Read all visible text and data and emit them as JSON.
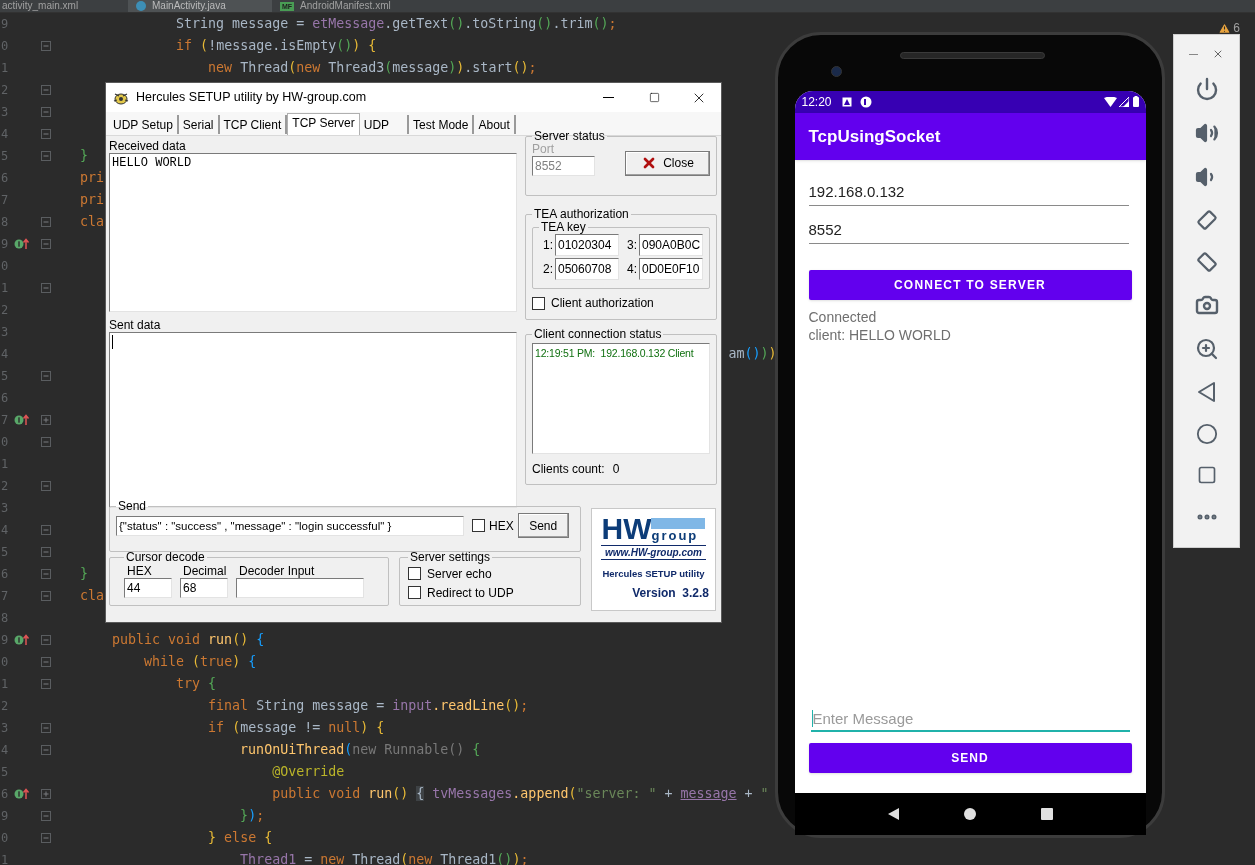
{
  "ide": {
    "tabs": [
      {
        "label": "activity_main.xml",
        "selected": false,
        "kind": "xml"
      },
      {
        "label": "MainActivity.java",
        "selected": true,
        "kind": "java"
      },
      {
        "label": "AndroidManifest.xml",
        "selected": false,
        "kind": "manifest",
        "badge": "MF"
      }
    ],
    "warnings": "6",
    "lines": [
      {
        "number": "9",
        "tokens": [
          {
            "text": "            String message = ",
            "kind": "plain"
          },
          {
            "text": "etMessage",
            "kind": "field"
          },
          {
            "text": ".getText",
            "kind": "plain"
          },
          {
            "text": "()",
            "kind": "b2"
          },
          {
            "text": ".toString",
            "kind": "plain"
          },
          {
            "text": "()",
            "kind": "b2"
          },
          {
            "text": ".trim",
            "kind": "plain"
          },
          {
            "text": "()",
            "kind": "b2"
          },
          {
            "text": ";",
            "kind": "kw"
          }
        ]
      },
      {
        "number": "0",
        "expanded": true,
        "tokens": [
          {
            "text": "            if ",
            "kind": "kw"
          },
          {
            "text": "(",
            "kind": "b1"
          },
          {
            "text": "!message.isEmpty",
            "kind": "plain"
          },
          {
            "text": "()",
            "kind": "b2"
          },
          {
            "text": ")",
            "kind": "b1"
          },
          {
            "text": " {",
            "kind": "b1"
          }
        ]
      },
      {
        "number": "1",
        "tokens": [
          {
            "text": "                new ",
            "kind": "kw"
          },
          {
            "text": "Thread",
            "kind": "plain"
          },
          {
            "text": "(",
            "kind": "b1"
          },
          {
            "text": "new ",
            "kind": "kw"
          },
          {
            "text": "Thread3",
            "kind": "plain"
          },
          {
            "text": "(",
            "kind": "b2"
          },
          {
            "text": "message",
            "kind": "plain"
          },
          {
            "text": ")",
            "kind": "b2"
          },
          {
            "text": ")",
            "kind": "b1"
          },
          {
            "text": ".start",
            "kind": "plain"
          },
          {
            "text": "()",
            "kind": "b1"
          },
          {
            "text": ";",
            "kind": "kw"
          }
        ]
      },
      {
        "number": "2",
        "expanded": true
      },
      {
        "number": "3",
        "expanded": true
      },
      {
        "number": "4",
        "expanded": true
      },
      {
        "number": "5",
        "expanded": true,
        "tokens": [
          {
            "text": "}",
            "kind": "b2"
          }
        ]
      },
      {
        "number": "6",
        "tokens": [
          {
            "text": "pri",
            "kind": "kw"
          }
        ]
      },
      {
        "number": "7",
        "tokens": [
          {
            "text": "pri",
            "kind": "kw"
          }
        ]
      },
      {
        "number": "8",
        "expanded": true,
        "tokens": [
          {
            "text": "cla",
            "kind": "kw"
          }
        ]
      },
      {
        "number": "9",
        "overridden": true,
        "expanded": true
      },
      {
        "number": "0"
      },
      {
        "number": "1",
        "expanded": true
      },
      {
        "number": "2"
      },
      {
        "number": "3"
      },
      {
        "number": "4",
        "tokens": [
          {
            "text": "                                                                                 am",
            "kind": "plain"
          },
          {
            "text": "()",
            "kind": "b3"
          },
          {
            "text": ")",
            "kind": "b2"
          },
          {
            "text": ")",
            "kind": "b1"
          }
        ]
      },
      {
        "number": "5",
        "expanded": true
      },
      {
        "number": "6"
      },
      {
        "number": "7",
        "overridden": true,
        "expanded": false
      },
      {
        "number": "0",
        "expanded": true
      },
      {
        "number": "1"
      },
      {
        "number": "2",
        "expanded": true
      },
      {
        "number": "3"
      },
      {
        "number": "4",
        "expanded": true
      },
      {
        "number": "5",
        "expanded": true
      },
      {
        "number": "6",
        "expanded": true,
        "tokens": [
          {
            "text": "}",
            "kind": "b2"
          }
        ]
      },
      {
        "number": "7",
        "expanded": true,
        "tokens": [
          {
            "text": "cla",
            "kind": "kw"
          }
        ]
      },
      {
        "number": "8"
      },
      {
        "number": "9",
        "overridden": true,
        "expanded": true,
        "tokens": [
          {
            "text": "    public void ",
            "kind": "kw"
          },
          {
            "text": "run",
            "kind": "method"
          },
          {
            "text": "()",
            "kind": "b1"
          },
          {
            "text": " {",
            "kind": "b3"
          }
        ]
      },
      {
        "number": "0",
        "expanded": true,
        "tokens": [
          {
            "text": "        while ",
            "kind": "kw"
          },
          {
            "text": "(",
            "kind": "b1"
          },
          {
            "text": "true",
            "kind": "kw"
          },
          {
            "text": ")",
            "kind": "b1"
          },
          {
            "text": " {",
            "kind": "b3"
          }
        ]
      },
      {
        "number": "1",
        "expanded": true,
        "tokens": [
          {
            "text": "            try ",
            "kind": "kw"
          },
          {
            "text": "{",
            "kind": "b2"
          }
        ]
      },
      {
        "number": "2",
        "tokens": [
          {
            "text": "                final ",
            "kind": "kw"
          },
          {
            "text": "String message = ",
            "kind": "plain"
          },
          {
            "text": "input",
            "kind": "field"
          },
          {
            "text": ".readLine",
            "kind": "method"
          },
          {
            "text": "()",
            "kind": "b1"
          },
          {
            "text": ";",
            "kind": "kw"
          }
        ]
      },
      {
        "number": "3",
        "expanded": true,
        "tokens": [
          {
            "text": "                if ",
            "kind": "kw"
          },
          {
            "text": "(",
            "kind": "b1"
          },
          {
            "text": "message != ",
            "kind": "plain"
          },
          {
            "text": "null",
            "kind": "kw"
          },
          {
            "text": ")",
            "kind": "b1"
          },
          {
            "text": " {",
            "kind": "b1"
          }
        ]
      },
      {
        "number": "4",
        "expanded": true,
        "tokens": [
          {
            "text": "                    runOnUiThread",
            "kind": "method"
          },
          {
            "text": "(",
            "kind": "b3"
          },
          {
            "text": "new Runnable",
            "kind": "dim"
          },
          {
            "text": "()",
            "kind": "dim"
          },
          {
            "text": " {",
            "kind": "b2"
          }
        ]
      },
      {
        "number": "5",
        "tokens": [
          {
            "text": "                        @Override",
            "kind": "ann"
          }
        ]
      },
      {
        "number": "6",
        "overridden": true,
        "expanded": false,
        "tokens": [
          {
            "text": "                        public void ",
            "kind": "kw"
          },
          {
            "text": "run",
            "kind": "method"
          },
          {
            "text": "() ",
            "kind": "b1"
          },
          {
            "text": "{",
            "kind": "hl"
          },
          {
            "text": " tvMessages",
            "kind": "field"
          },
          {
            "text": ".append",
            "kind": "method"
          },
          {
            "text": "(",
            "kind": "b1"
          },
          {
            "text": "\"server: \"",
            "kind": "string"
          },
          {
            "text": " + ",
            "kind": "plain"
          },
          {
            "text": "message",
            "kind": "fieldu"
          },
          {
            "text": " + ",
            "kind": "plain"
          },
          {
            "text": "\"",
            "kind": "string"
          }
        ]
      },
      {
        "number": "9",
        "expanded": true,
        "tokens": [
          {
            "text": "                    }",
            "kind": "b2"
          },
          {
            "text": ")",
            "kind": "b3"
          },
          {
            "text": ";",
            "kind": "kw"
          }
        ]
      },
      {
        "number": "0",
        "expanded": true,
        "tokens": [
          {
            "text": "                }",
            "kind": "b1"
          },
          {
            "text": " else ",
            "kind": "kw"
          },
          {
            "text": "{",
            "kind": "b1"
          }
        ]
      },
      {
        "number": "1",
        "tokens": [
          {
            "text": "                    Thread1",
            "kind": "field"
          },
          {
            "text": " = ",
            "kind": "plain"
          },
          {
            "text": "new ",
            "kind": "kw"
          },
          {
            "text": "Thread",
            "kind": "plain"
          },
          {
            "text": "(",
            "kind": "b1"
          },
          {
            "text": "new ",
            "kind": "kw"
          },
          {
            "text": "Thread1",
            "kind": "plain"
          },
          {
            "text": "()",
            "kind": "b2"
          },
          {
            "text": ")",
            "kind": "b1"
          },
          {
            "text": ";",
            "kind": "kw"
          }
        ]
      }
    ]
  },
  "hercules": {
    "title": "Hercules SETUP utility by HW-group.com",
    "tabs": [
      {
        "label": "UDP Setup",
        "selected": false
      },
      {
        "label": "Serial",
        "selected": false
      },
      {
        "label": "TCP Client",
        "selected": false
      },
      {
        "label": "TCP Server",
        "selected": true
      },
      {
        "label": "UDP",
        "selected": false
      },
      {
        "label": "Test Mode",
        "selected": false
      },
      {
        "label": "About",
        "selected": false
      }
    ],
    "received_data": {
      "label": "Received data",
      "text": "HELLO WORLD"
    },
    "sent_data": {
      "label": "Sent data"
    },
    "server_status": {
      "label": "Server status",
      "port_label": "Port",
      "port": "8552",
      "disabled": true,
      "close_button": "Close"
    },
    "tea_authorization": {
      "label": "TEA authorization",
      "key_label": "TEA key",
      "keys": [
        {
          "index": "1:",
          "value": "01020304"
        },
        {
          "index": "3:",
          "value": "090A0B0C"
        },
        {
          "index": "2:",
          "value": "05060708"
        },
        {
          "index": "4:",
          "value": "0D0E0F10"
        }
      ],
      "client_authorization": {
        "label": "Client authorization",
        "checked": false
      }
    },
    "client_connection_status": {
      "label": "Client connection status",
      "entries": [
        "12:19:51 PM:  192.168.0.132 Client"
      ],
      "count_label": "Clients count:",
      "count": "0"
    },
    "send": {
      "label": "Send",
      "value": "{\"status\" : \"success\" , \"message\" : \"login successful\" }",
      "hex": {
        "label": "HEX",
        "checked": false
      },
      "button": "Send"
    },
    "cursor_decode": {
      "label": "Cursor decode",
      "fields": [
        {
          "label": "HEX",
          "value": "44"
        },
        {
          "label": "Decimal",
          "value": "68"
        },
        {
          "label": "Decoder Input"
        }
      ]
    },
    "server_settings": {
      "label": "Server settings",
      "options": [
        {
          "label": "Server echo",
          "checked": false
        },
        {
          "label": "Redirect to UDP",
          "checked": false
        }
      ]
    },
    "logo": {
      "mark": "HW",
      "word": "group",
      "url": "www.HW-group.com",
      "product": "Hercules SETUP utility",
      "version": "Version  3.2.8"
    }
  },
  "emulator": {
    "status_time": "12:20",
    "app_title": "TcpUsingSocket",
    "fields": [
      {
        "value": "192.168.0.132"
      },
      {
        "value": "8552"
      }
    ],
    "connect_button": "CONNECT TO SERVER",
    "messages": [
      "Connected",
      "client: HELLO WORLD"
    ],
    "message_field": {
      "placeholder": "Enter Message",
      "focused": true
    },
    "send_button": "SEND"
  }
}
